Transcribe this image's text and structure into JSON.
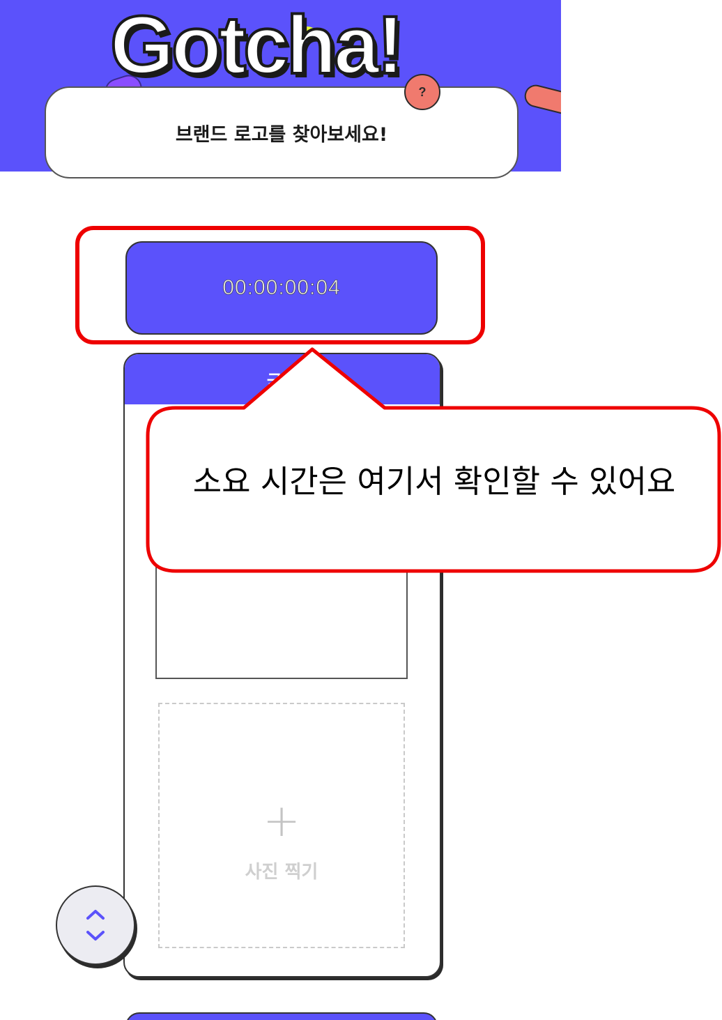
{
  "header": {
    "logo_text": "Gotcha!",
    "title": "브랜드 로고를 찾아보세요!",
    "help_label": "?"
  },
  "timer": {
    "value": "00:00:00:04"
  },
  "card": {
    "header_label": "국민",
    "photo_label": "사진 찍기",
    "plus_symbol": "+"
  },
  "tooltip": {
    "text": "소요 시간은 여기서 확인할 수 있어요"
  },
  "colors": {
    "brand": "#5b52fb",
    "accent": "#f07a6e",
    "highlight": "#ee0000"
  },
  "icons": {
    "scroll": "chevron-up-down-icon"
  }
}
